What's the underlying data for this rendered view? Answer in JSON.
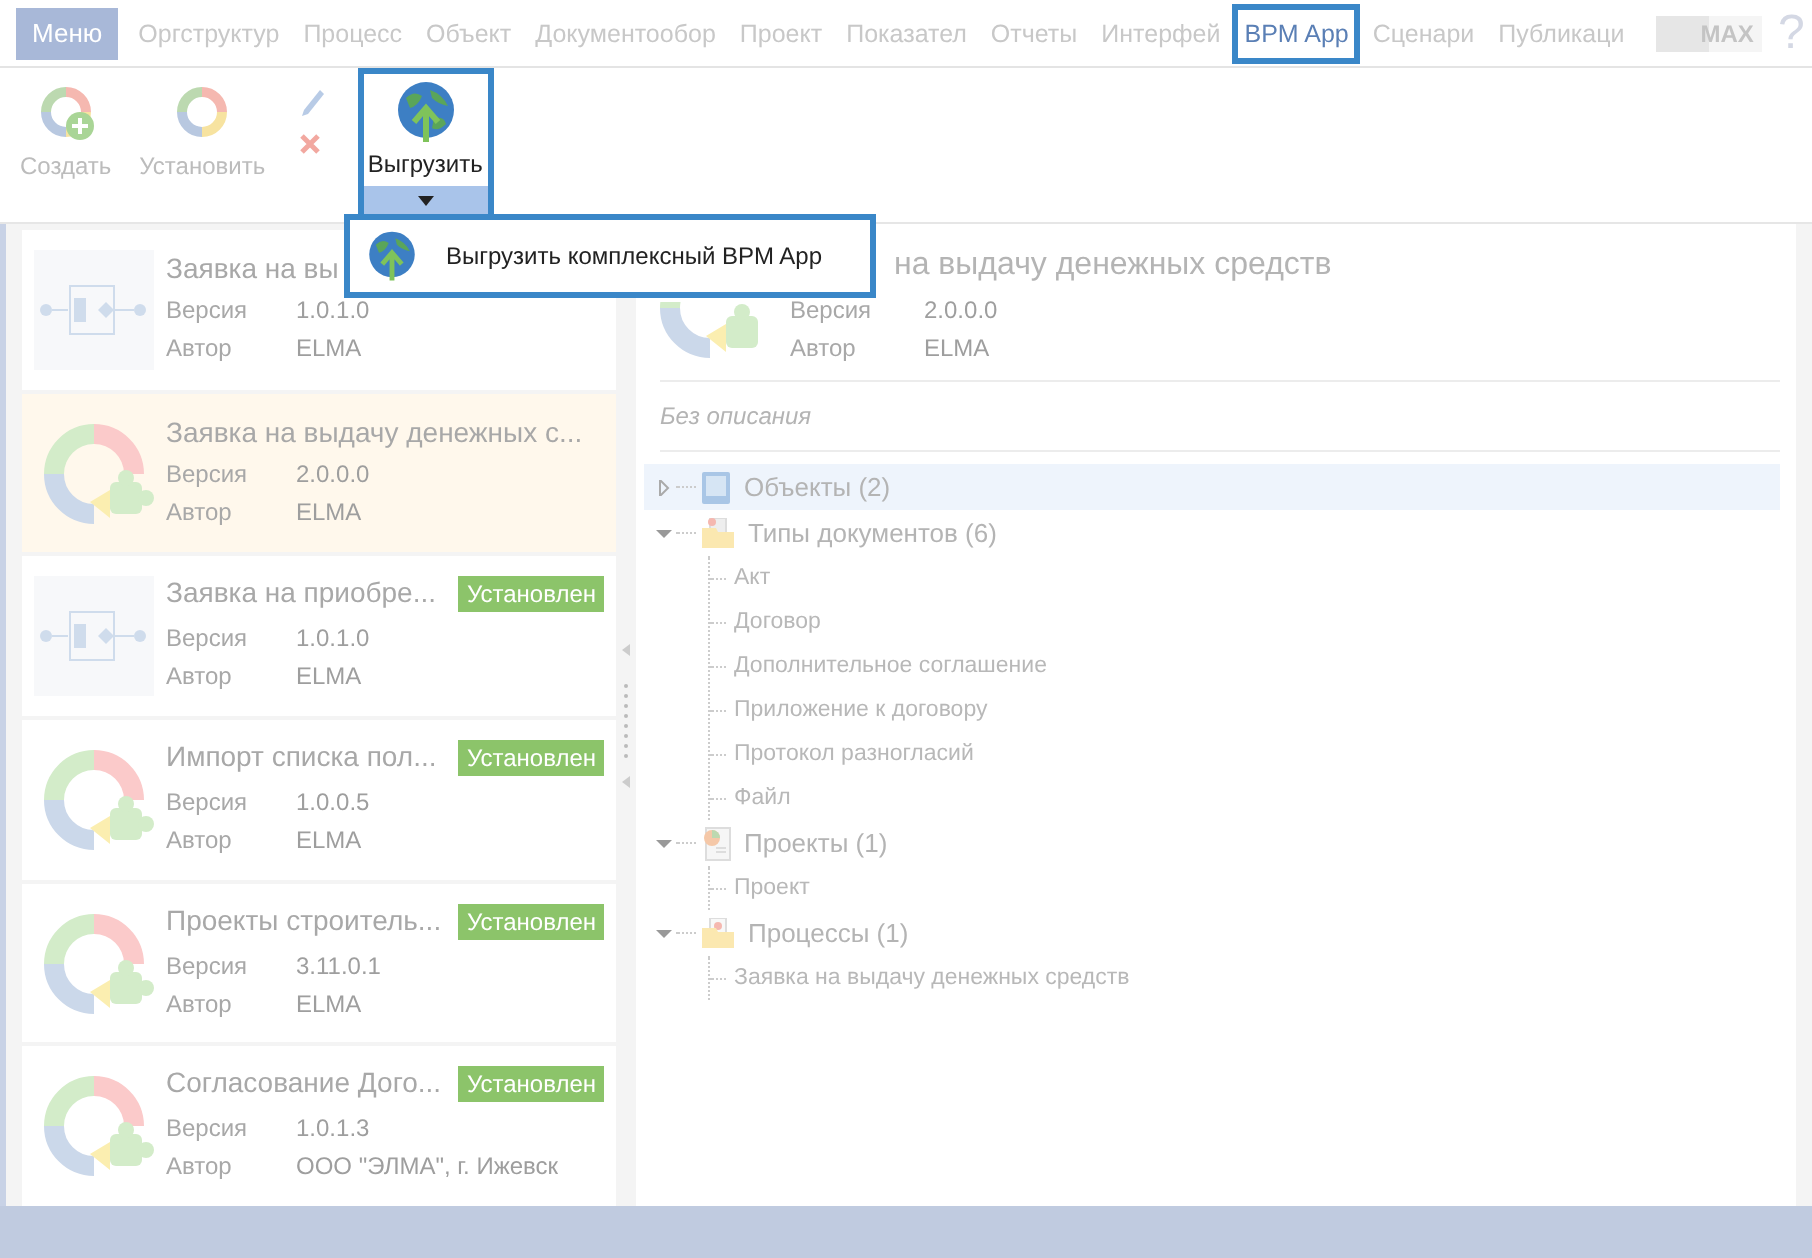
{
  "menu_button": {
    "label": "Меню"
  },
  "tabs": [
    {
      "label": "Оргструктур",
      "selected": false
    },
    {
      "label": "Процесс",
      "selected": false
    },
    {
      "label": "Объект",
      "selected": false
    },
    {
      "label": "Документообор",
      "selected": false
    },
    {
      "label": "Проект",
      "selected": false
    },
    {
      "label": "Показател",
      "selected": false
    },
    {
      "label": "Отчеты",
      "selected": false
    },
    {
      "label": "Интерфей",
      "selected": false
    },
    {
      "label": "BPM App",
      "selected": true
    },
    {
      "label": "Сценари",
      "selected": false
    },
    {
      "label": "Публикаци",
      "selected": false
    }
  ],
  "toggle": {
    "label": "MAX"
  },
  "help": {
    "label": "?"
  },
  "ribbon": {
    "buttons": [
      {
        "label": "Создать",
        "kind": "create"
      },
      {
        "label": "Установить",
        "kind": "install"
      }
    ],
    "export": {
      "label": "Выгрузить",
      "expanded": true
    },
    "menu": [
      {
        "label": "Выгрузить комплексный BPM App"
      }
    ]
  },
  "apps": [
    {
      "title": "Заявка на вы",
      "kind": "process",
      "version_label": "Версия",
      "version": "1.0.1.0",
      "author_label": "Автор",
      "author": "ELMA",
      "selected": false
    },
    {
      "title": "Заявка на выдачу денежных с...",
      "kind": "cycle",
      "version_label": "Версия",
      "version": "2.0.0.0",
      "author_label": "Автор",
      "author": "ELMA",
      "selected": true
    },
    {
      "title": "Заявка на приобре...",
      "kind": "process",
      "status": "Установлен",
      "version_label": "Версия",
      "version": "1.0.1.0",
      "author_label": "Автор",
      "author": "ELMA",
      "selected": false
    },
    {
      "title": "Импорт списка пол...",
      "kind": "cycle",
      "status": "Установлен",
      "version_label": "Версия",
      "version": "1.0.0.5",
      "author_label": "Автор",
      "author": "ELMA",
      "selected": false
    },
    {
      "title": "Проекты строитель...",
      "kind": "cycle",
      "status": "Установлен",
      "version_label": "Версия",
      "version": "3.11.0.1",
      "author_label": "Автор",
      "author": "ELMA",
      "selected": false
    },
    {
      "title": "Согласование Дого...",
      "kind": "cycle",
      "status": "Установлен",
      "version_label": "Версия",
      "version": "1.0.1.3",
      "author_label": "Автор",
      "author": "ООО \"ЭЛМА\", г. Ижевск",
      "selected": false
    }
  ],
  "detail": {
    "title": "на выдачу денежных средств",
    "version_label": "Версия",
    "version": "2.0.0.0",
    "author_label": "Автор",
    "author": "ELMA",
    "description": "Без описания",
    "tree": [
      {
        "label": "Объекты (2)",
        "kind": "objects",
        "expanded": false,
        "selected": true
      },
      {
        "label": "Типы документов (6)",
        "kind": "doc_types",
        "expanded": true,
        "selected": false,
        "children": [
          {
            "label": "Акт"
          },
          {
            "label": "Договор"
          },
          {
            "label": "Дополнительное соглашение"
          },
          {
            "label": "Приложение к договору"
          },
          {
            "label": "Протокол разногласий"
          },
          {
            "label": "Файл"
          }
        ]
      },
      {
        "label": "Проекты (1)",
        "kind": "projects",
        "expanded": true,
        "selected": false,
        "children": [
          {
            "label": "Проект"
          }
        ]
      },
      {
        "label": "Процессы (1)",
        "kind": "processes",
        "expanded": true,
        "selected": false,
        "children": [
          {
            "label": "Заявка на выдачу денежных средств"
          }
        ]
      }
    ]
  }
}
